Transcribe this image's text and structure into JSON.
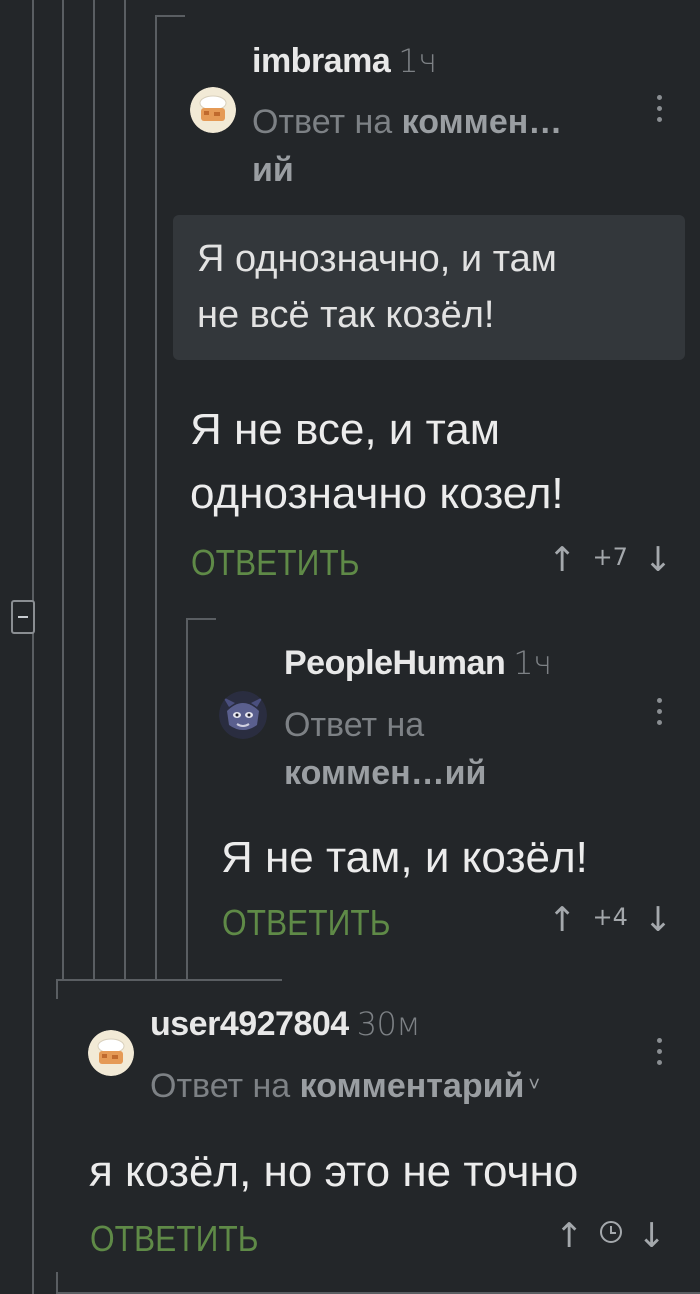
{
  "comments": [
    {
      "username": "imbrama",
      "time": "1ч",
      "reply_prefix": "Ответ на ",
      "reply_target_line1": "коммен…",
      "reply_target_line2": "ий",
      "quote": "Я однозначно, и там\nне всё так козёл!",
      "text": "Я не все, и там\nоднозначно козел!",
      "reply_label": "ОТВЕТИТЬ",
      "rating": "+7"
    },
    {
      "username": "PeopleHuman",
      "time": "1ч",
      "reply_prefix": "Ответ на",
      "reply_target": "коммен…ий",
      "text": "Я не там, и козёл!",
      "reply_label": "ОТВЕТИТЬ",
      "rating": "+4"
    },
    {
      "username": "user4927804",
      "time": "30м",
      "reply_prefix": "Ответ на ",
      "reply_target": "комментарий",
      "text": "я козёл, но это не точно",
      "reply_label": "ОТВЕТИТЬ"
    }
  ],
  "icons": {
    "vote_up": "↑",
    "vote_down": "↓",
    "chevron": "˅"
  }
}
